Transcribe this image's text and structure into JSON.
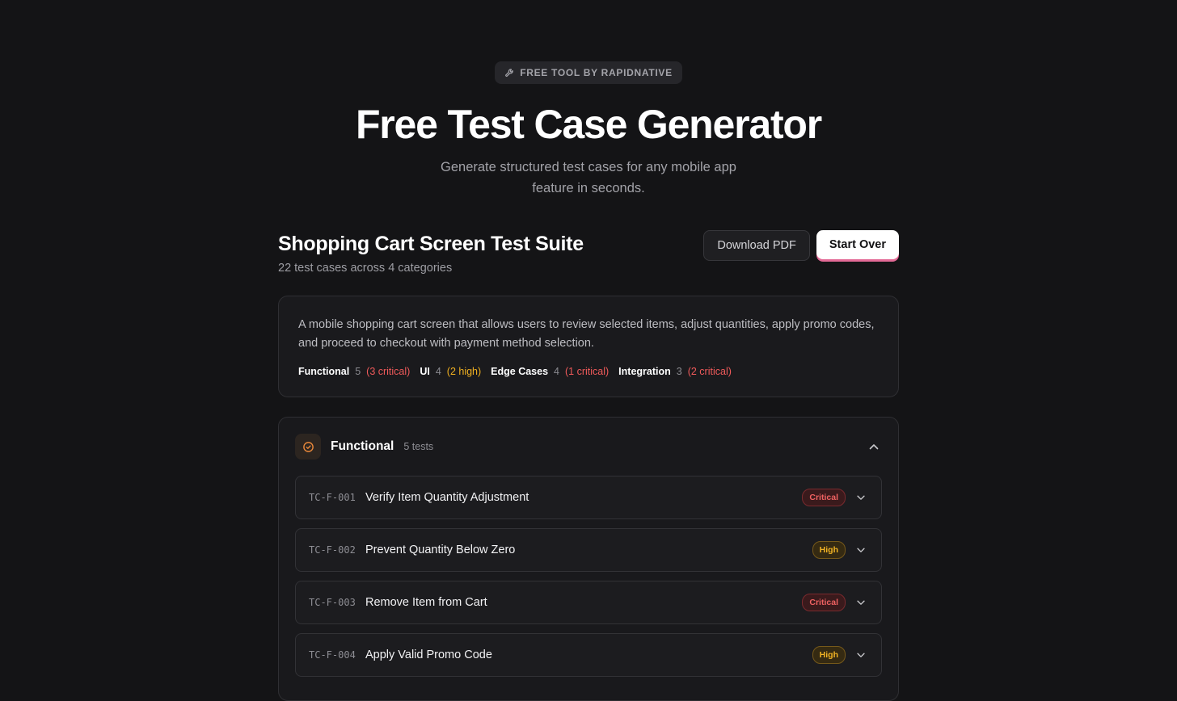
{
  "hero": {
    "badge": "FREE TOOL BY RAPIDNATIVE",
    "title": "Free Test Case Generator",
    "subtitle": "Generate structured test cases for any mobile app feature in seconds."
  },
  "suite": {
    "title": "Shopping Cart Screen Test Suite",
    "count_text": "22 test cases across 4 categories",
    "download_label": "Download PDF",
    "start_over_label": "Start Over"
  },
  "summary": {
    "description": "A mobile shopping cart screen that allows users to review selected items, adjust quantities, apply promo codes, and proceed to checkout with payment method selection.",
    "stats": [
      {
        "name": "Functional",
        "count": "5",
        "detail": "(3 critical)",
        "level": "critical"
      },
      {
        "name": "UI",
        "count": "4",
        "detail": "(2 high)",
        "level": "high"
      },
      {
        "name": "Edge Cases",
        "count": "4",
        "detail": "(1 critical)",
        "level": "critical"
      },
      {
        "name": "Integration",
        "count": "3",
        "detail": "(2 critical)",
        "level": "critical"
      }
    ]
  },
  "category": {
    "icon": "check-circle-icon",
    "title": "Functional",
    "count": "5 tests",
    "accent": "#e8873a",
    "tests": [
      {
        "id": "TC-F-001",
        "title": "Verify Item Quantity Adjustment",
        "priority": "Critical"
      },
      {
        "id": "TC-F-002",
        "title": "Prevent Quantity Below Zero",
        "priority": "High"
      },
      {
        "id": "TC-F-003",
        "title": "Remove Item from Cart",
        "priority": "Critical"
      },
      {
        "id": "TC-F-004",
        "title": "Apply Valid Promo Code",
        "priority": "High"
      }
    ]
  },
  "colors": {
    "background": "#141416",
    "critical": "#ef5a5a",
    "high": "#f0b020"
  }
}
